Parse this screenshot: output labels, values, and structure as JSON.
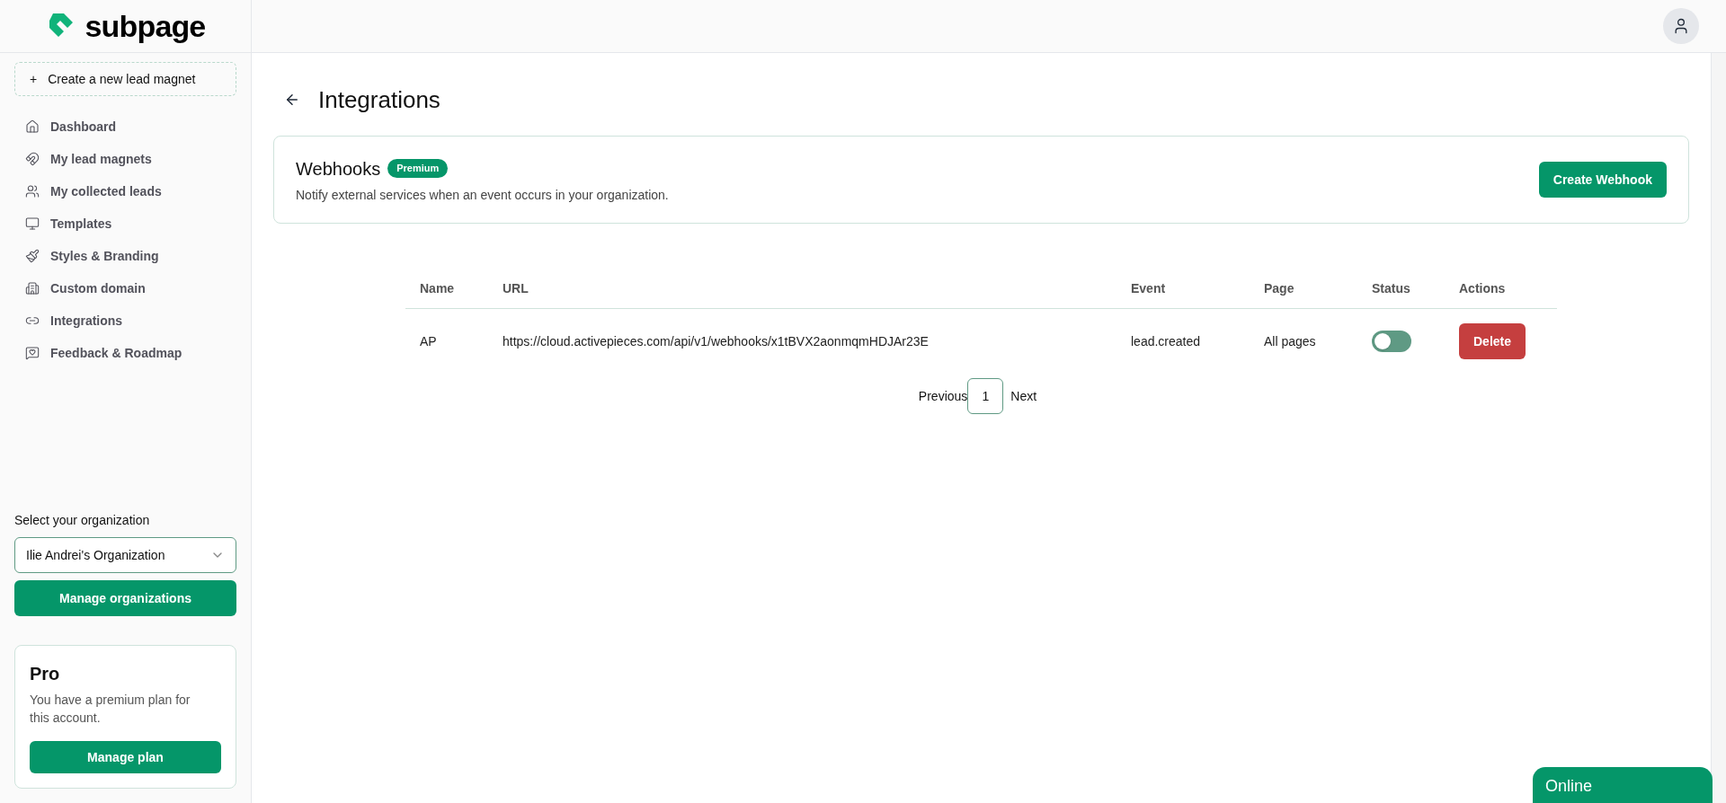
{
  "logo": {
    "text": "subpage"
  },
  "sidebar": {
    "create_button": {
      "icon": "+",
      "label": "Create a new lead magnet"
    },
    "items": [
      {
        "label": "Dashboard"
      },
      {
        "label": "My lead magnets"
      },
      {
        "label": "My collected leads"
      },
      {
        "label": "Templates"
      },
      {
        "label": "Styles & Branding"
      },
      {
        "label": "Custom domain"
      },
      {
        "label": "Integrations"
      },
      {
        "label": "Feedback & Roadmap"
      }
    ],
    "organization": {
      "label": "Select your organization",
      "value": "Ilie Andrei's Organization",
      "button": "Manage organizations"
    },
    "plan": {
      "title": "Pro",
      "text": "You have a premium plan for this account.",
      "button": "Manage plan"
    }
  },
  "page": {
    "title": "Integrations"
  },
  "webhooks_card": {
    "title": "Webhooks",
    "badge": "Premium",
    "description": "Notify external services when an event occurs in your organization.",
    "button": "Create Webhook"
  },
  "table": {
    "columns": [
      "Name",
      "URL",
      "Event",
      "Page",
      "Status",
      "Actions"
    ],
    "rows": [
      {
        "name": "AP",
        "url": "https://cloud.activepieces.com/api/v1/webhooks/x1tBVX2aonmqmHDJAr23E",
        "event": "lead.created",
        "page": "All pages",
        "on": false,
        "action": "Delete"
      }
    ]
  },
  "pagination": {
    "previous": "Previous",
    "pages": [
      {
        "label": "1",
        "selected": true
      }
    ],
    "next": "Next"
  },
  "chat": {
    "label": "Online"
  }
}
